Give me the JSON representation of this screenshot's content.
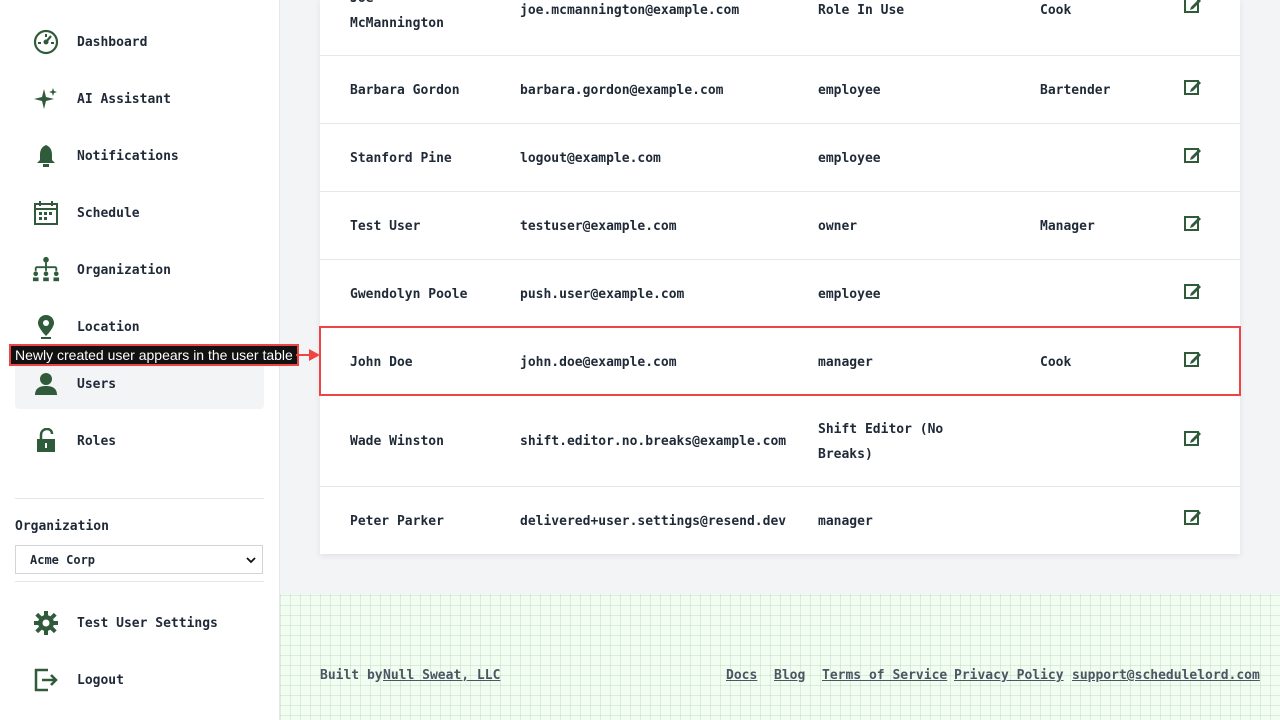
{
  "sidebar": {
    "nav_items": [
      {
        "label": "Dashboard",
        "icon": "dashboard-icon"
      },
      {
        "label": "AI Assistant",
        "icon": "sparkle-icon"
      },
      {
        "label": "Notifications",
        "icon": "bell-icon"
      },
      {
        "label": "Schedule",
        "icon": "calendar-icon"
      },
      {
        "label": "Organization",
        "icon": "org-chart-icon"
      },
      {
        "label": "Location",
        "icon": "map-pin-icon"
      },
      {
        "label": "Users",
        "icon": "user-icon",
        "active": true
      },
      {
        "label": "Roles",
        "icon": "unlock-icon"
      }
    ],
    "organization_label": "Organization",
    "organization_selected": "Acme Corp",
    "settings_label": "Test User Settings",
    "logout_label": "Logout"
  },
  "users_table": {
    "rows": [
      {
        "name": "Joe McMannington",
        "email": "joe.mcmannington@example.com",
        "role": "Role In Use",
        "position": "Cook"
      },
      {
        "name": "Barbara Gordon",
        "email": "barbara.gordon@example.com",
        "role": "employee",
        "position": "Bartender"
      },
      {
        "name": "Stanford Pine",
        "email": "logout@example.com",
        "role": "employee",
        "position": ""
      },
      {
        "name": "Test User",
        "email": "testuser@example.com",
        "role": "owner",
        "position": "Manager"
      },
      {
        "name": "Gwendolyn Poole",
        "email": "push.user@example.com",
        "role": "employee",
        "position": ""
      },
      {
        "name": "John Doe",
        "email": "john.doe@example.com",
        "role": "manager",
        "position": "Cook"
      },
      {
        "name": "Wade Winston",
        "email": "shift.editor.no.breaks@example.com",
        "role": "Shift Editor (No Breaks)",
        "position": ""
      },
      {
        "name": "Peter Parker",
        "email": "delivered+user.settings@resend.dev",
        "role": "manager",
        "position": ""
      }
    ]
  },
  "annotation": {
    "text": "Newly created user appears in the user table",
    "color": "#ef4444"
  },
  "footer": {
    "built_by_prefix": "Built by",
    "built_by_link": "Null Sweat, LLC",
    "links": [
      "Docs",
      "Blog",
      "Terms of Service",
      "Privacy Policy",
      "support@schedulelord.com"
    ]
  },
  "colors": {
    "brand_green": "#2f5b3a",
    "footer_bg": "#f0fdf0"
  }
}
